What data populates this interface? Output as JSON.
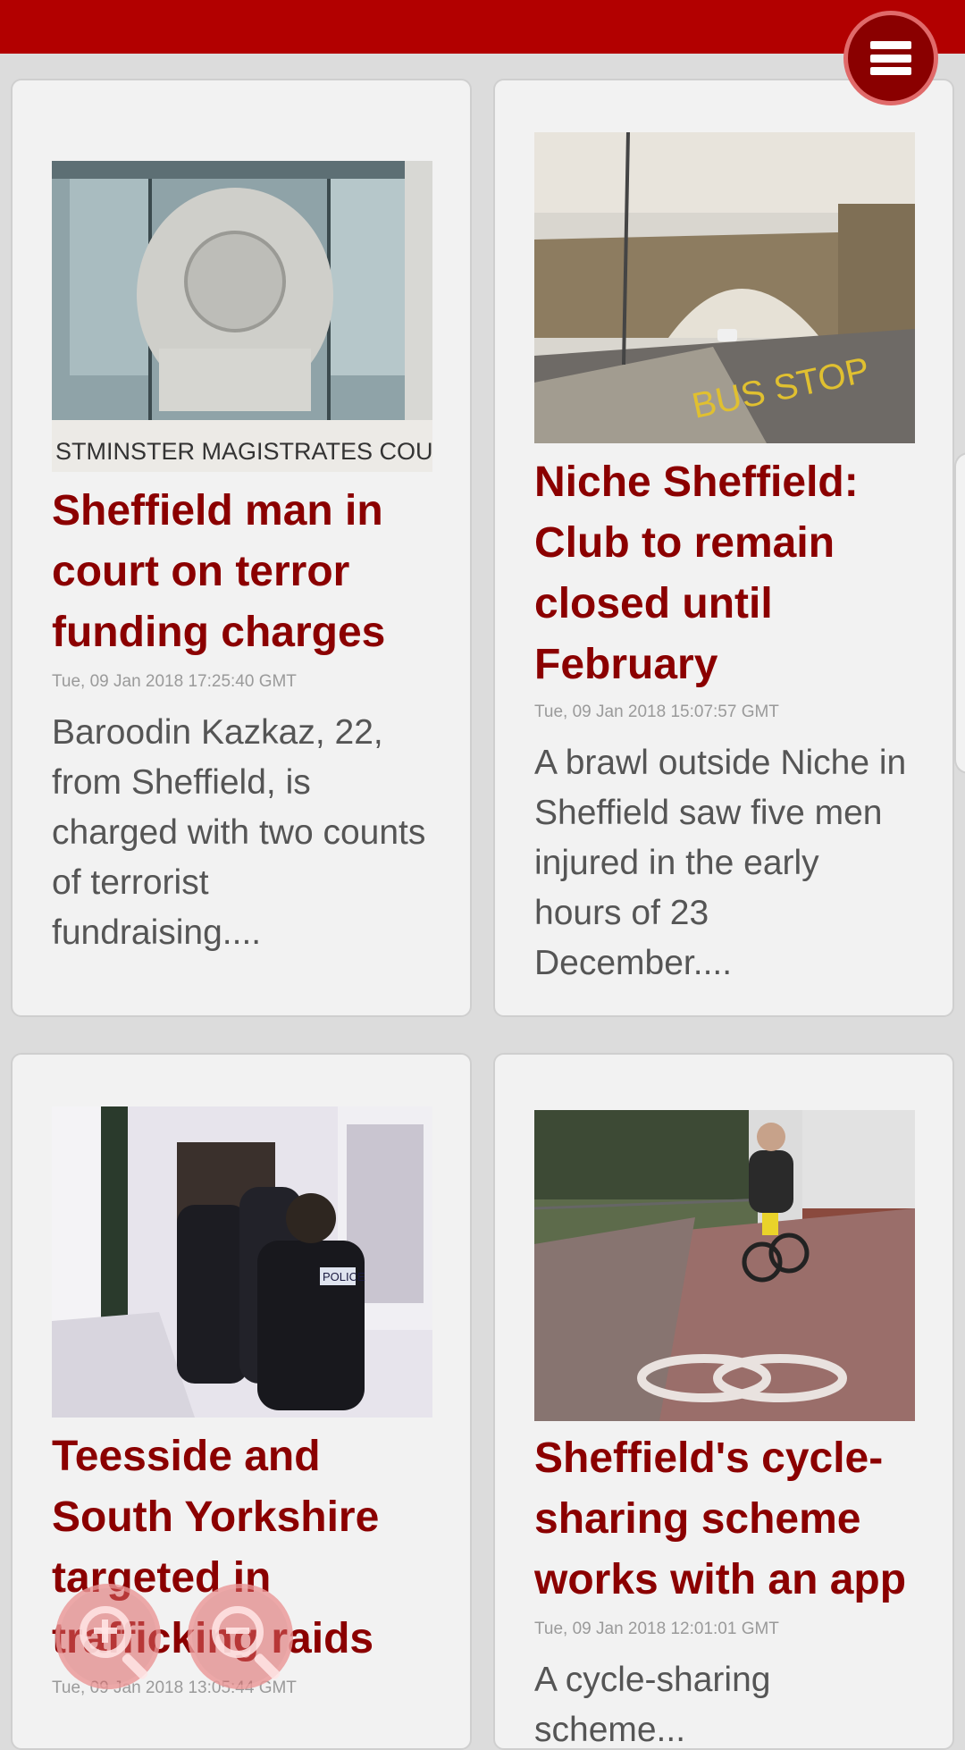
{
  "header": {
    "menu_icon": "hamburger-menu-icon"
  },
  "articles": [
    {
      "title": "Sheffield man in court on terror funding charges",
      "date": "Tue, 09 Jan 2018 17:25:40 GMT",
      "summary": "Baroodin Kazkaz, 22, from Sheffield, is charged with two counts of terrorist fundraising....",
      "image_caption": "STMINSTER MAGISTRATES COUR"
    },
    {
      "title": "Niche Sheffield: Club to remain closed until February",
      "date": "Tue, 09 Jan 2018 15:07:57 GMT",
      "summary": "A brawl outside Niche in Sheffield saw five men injured in the early hours of 23 December....",
      "image_road_text": "BUS STOP"
    },
    {
      "title": "Teesside and South Yorkshire targeted in trafficking raids",
      "date": "Tue, 09 Jan 2018 13:05:44 GMT",
      "summary": "",
      "image_vest_text": "POLICE"
    },
    {
      "title": "Sheffield's cycle-sharing scheme works with an app",
      "date": "Tue, 09 Jan 2018 12:01:01 GMT",
      "summary": "A cycle-sharing scheme..."
    }
  ],
  "zoom": {
    "in_icon": "zoom-in-icon",
    "out_icon": "zoom-out-icon"
  },
  "colors": {
    "brand": "#b20000",
    "title": "#8b0000"
  }
}
